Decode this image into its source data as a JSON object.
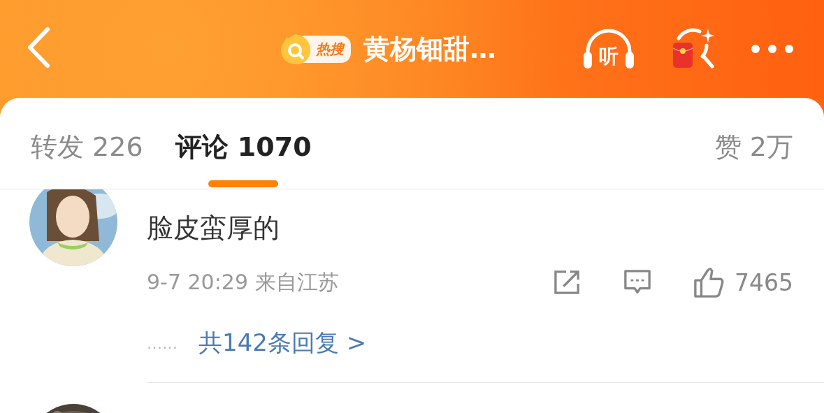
{
  "header": {
    "badge": "热搜",
    "title": "黄杨钿甜…",
    "listen_label": "听"
  },
  "tabs": [
    {
      "label": "转发",
      "count": "226",
      "selected": false
    },
    {
      "label": "评论",
      "count": "1070",
      "selected": true
    }
  ],
  "likes_tab": {
    "label": "赞",
    "count": "2万"
  },
  "comments": [
    {
      "text": "脸皮蛮厚的",
      "time": "9-7 20:29",
      "location": "来自江苏",
      "likes": "7465",
      "replies": "共142条回复 >",
      "reply_dots": "……"
    }
  ]
}
